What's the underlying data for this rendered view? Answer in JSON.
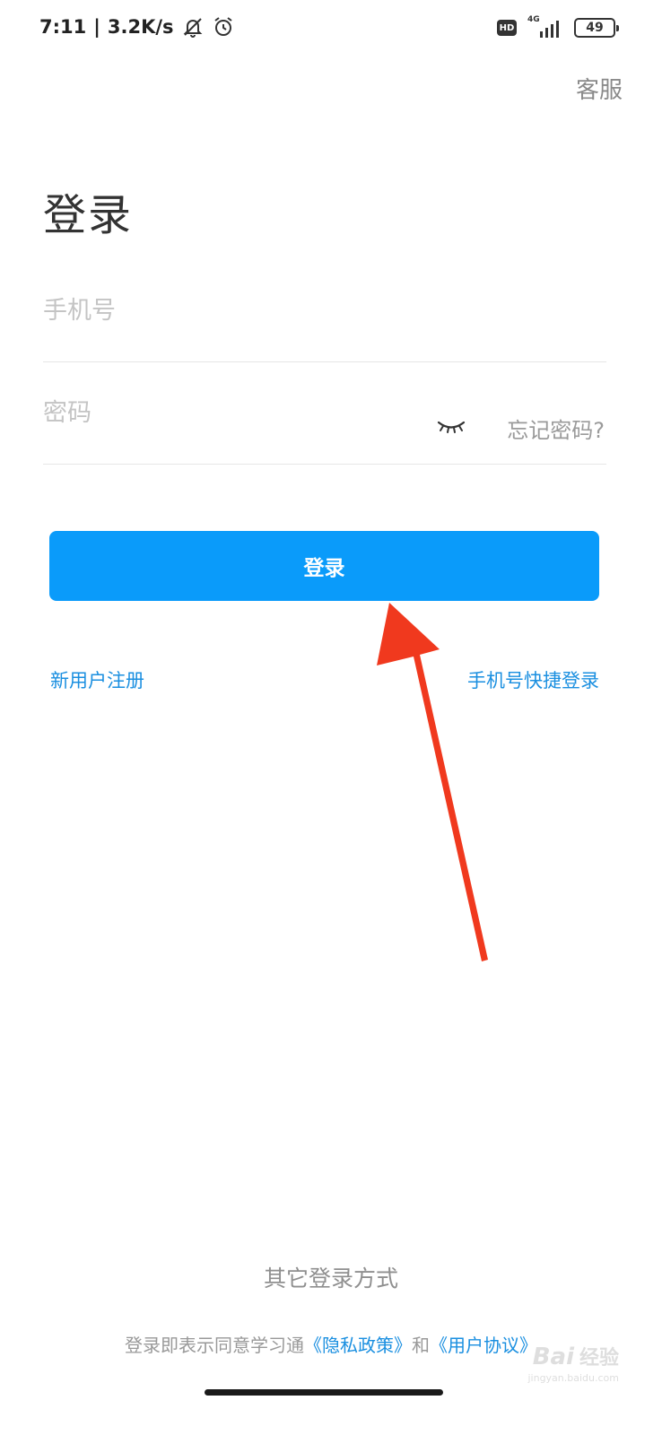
{
  "status_bar": {
    "time": "7:11",
    "net_speed": "3.2K/s",
    "hd_label": "HD",
    "network_type": "4G",
    "battery_level": "49",
    "icons": [
      "mute-icon",
      "alarm-icon",
      "hd-icon",
      "signal-icon",
      "battery-icon"
    ]
  },
  "header": {
    "customer_service": "客服"
  },
  "page_title": "登录",
  "form": {
    "phone_placeholder": "手机号",
    "phone_value": "",
    "password_placeholder": "密码",
    "password_value": "",
    "forgot_label": "忘记密码?"
  },
  "login_button_label": "登录",
  "links": {
    "register": "新用户注册",
    "quick_login": "手机号快捷登录"
  },
  "other_login": "其它登录方式",
  "agreement": {
    "prefix": "登录即表示同意学习通",
    "privacy": "《隐私政策》",
    "and": "和",
    "terms": "《用户协议》"
  },
  "watermark": {
    "logo": "Bai",
    "logo_suffix": "经验",
    "site": "jingyan.baidu.com"
  },
  "colors": {
    "primary": "#0a9bfa",
    "link": "#1a8fe0",
    "annotation": "#f0391e"
  }
}
